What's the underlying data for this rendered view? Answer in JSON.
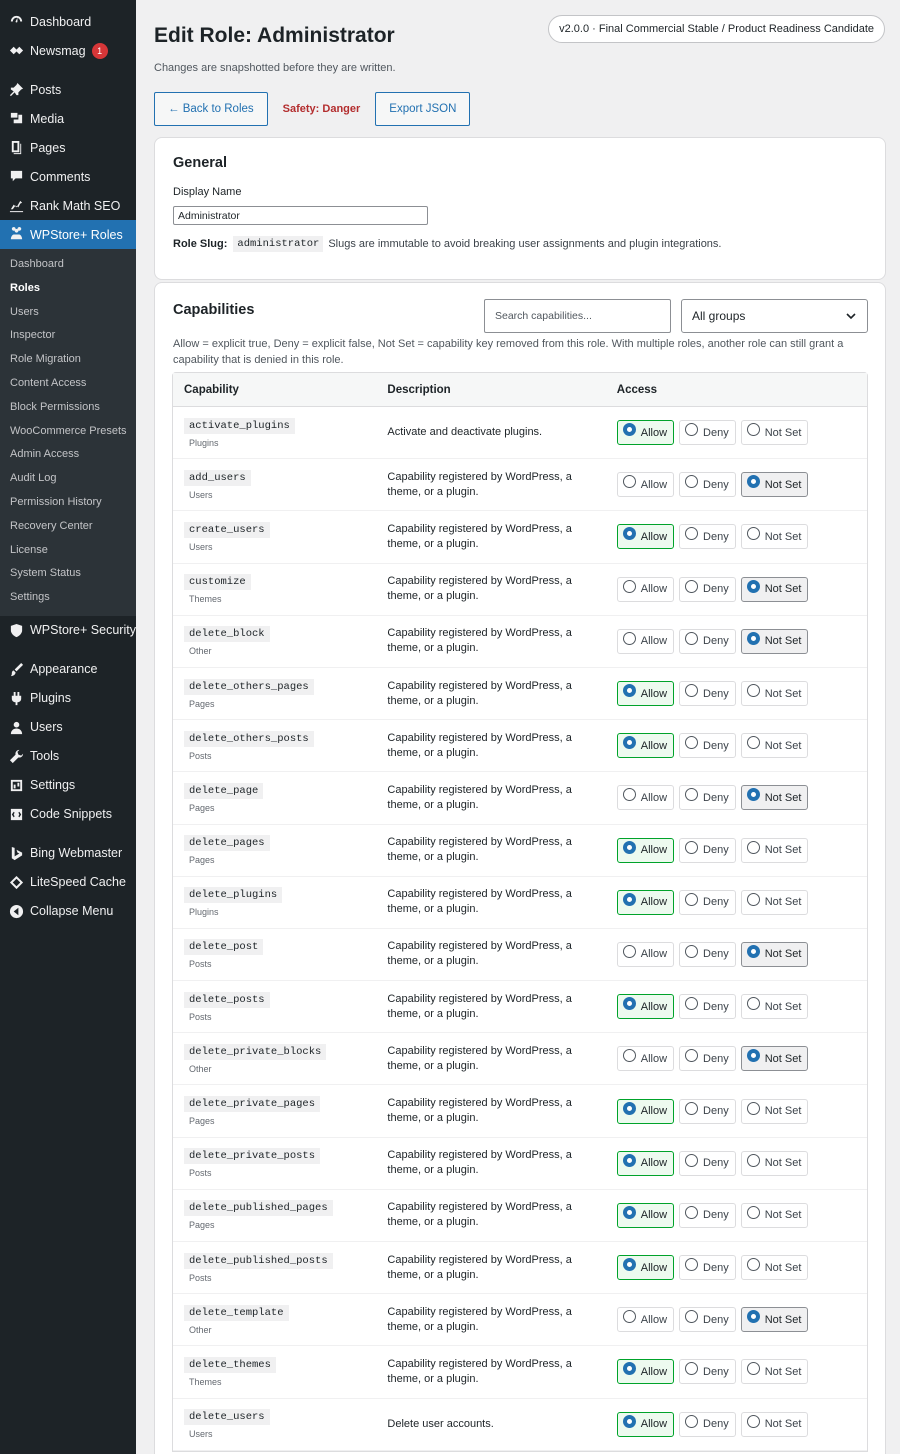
{
  "sidebar": {
    "top_items": [
      {
        "label": "Dashboard",
        "icon": "dashboard-icon"
      },
      {
        "label": "Newsmag",
        "icon": "newsmag-icon",
        "badge": "1"
      }
    ],
    "content_items": [
      {
        "label": "Posts",
        "icon": "pin-icon"
      },
      {
        "label": "Media",
        "icon": "media-icon"
      },
      {
        "label": "Pages",
        "icon": "pages-icon"
      },
      {
        "label": "Comments",
        "icon": "comments-icon"
      },
      {
        "label": "Rank Math SEO",
        "icon": "chart-icon"
      }
    ],
    "current_item": {
      "label": "WPStore+ Roles",
      "icon": "roles-icon"
    },
    "submenu": [
      "Dashboard",
      "Roles",
      "Users",
      "Inspector",
      "Role Migration",
      "Content Access",
      "Block Permissions",
      "WooCommerce Presets",
      "Admin Access",
      "Audit Log",
      "Permission History",
      "Recovery Center",
      "License",
      "System Status",
      "Settings"
    ],
    "submenu_current": "Roles",
    "security_item": {
      "label": "WPStore+ Security",
      "icon": "shield-icon"
    },
    "admin_items": [
      {
        "label": "Appearance",
        "icon": "brush-icon"
      },
      {
        "label": "Plugins",
        "icon": "plugin-icon"
      },
      {
        "label": "Users",
        "icon": "user-icon"
      },
      {
        "label": "Tools",
        "icon": "wrench-icon"
      },
      {
        "label": "Settings",
        "icon": "settings-icon"
      },
      {
        "label": "Code Snippets",
        "icon": "code-icon"
      }
    ],
    "extra_items": [
      {
        "label": "Bing Webmaster",
        "icon": "bing-icon"
      },
      {
        "label": "LiteSpeed Cache",
        "icon": "diamond-icon"
      },
      {
        "label": "Collapse Menu",
        "icon": "collapse-icon"
      }
    ]
  },
  "header": {
    "version": "v2.0.0 · Final Commercial Stable / Product Readiness Candidate",
    "title": "Edit Role: Administrator",
    "subtitle": "Changes are snapshotted before they are written.",
    "back_label": "← Back to Roles",
    "safety_label": "Safety: Danger",
    "export_label": "Export JSON"
  },
  "general": {
    "title": "General",
    "display_name_label": "Display Name",
    "display_name_value": "Administrator",
    "slug_label": "Role Slug:",
    "slug_value": "administrator",
    "slug_note": "Slugs are immutable to avoid breaking user assignments and plugin integrations."
  },
  "capabilities": {
    "title": "Capabilities",
    "search_placeholder": "Search capabilities...",
    "group_select": "All groups",
    "help": "Allow = explicit true, Deny = explicit false, Not Set = capability key removed from this role. With multiple roles, another role can still grant a capability that is denied in this role.",
    "columns": [
      "Capability",
      "Description",
      "Access"
    ],
    "options": {
      "allow": "Allow",
      "deny": "Deny",
      "notset": "Not Set"
    },
    "rows": [
      {
        "name": "activate_plugins",
        "group": "Plugins",
        "desc": "Activate and deactivate plugins.",
        "access": "allow"
      },
      {
        "name": "add_users",
        "group": "Users",
        "desc": "Capability registered by WordPress, a theme, or a plugin.",
        "access": "notset"
      },
      {
        "name": "create_users",
        "group": "Users",
        "desc": "Capability registered by WordPress, a theme, or a plugin.",
        "access": "allow"
      },
      {
        "name": "customize",
        "group": "Themes",
        "desc": "Capability registered by WordPress, a theme, or a plugin.",
        "access": "notset"
      },
      {
        "name": "delete_block",
        "group": "Other",
        "desc": "Capability registered by WordPress, a theme, or a plugin.",
        "access": "notset"
      },
      {
        "name": "delete_others_pages",
        "group": "Pages",
        "desc": "Capability registered by WordPress, a theme, or a plugin.",
        "access": "allow"
      },
      {
        "name": "delete_others_posts",
        "group": "Posts",
        "desc": "Capability registered by WordPress, a theme, or a plugin.",
        "access": "allow"
      },
      {
        "name": "delete_page",
        "group": "Pages",
        "desc": "Capability registered by WordPress, a theme, or a plugin.",
        "access": "notset"
      },
      {
        "name": "delete_pages",
        "group": "Pages",
        "desc": "Capability registered by WordPress, a theme, or a plugin.",
        "access": "allow"
      },
      {
        "name": "delete_plugins",
        "group": "Plugins",
        "desc": "Capability registered by WordPress, a theme, or a plugin.",
        "access": "allow"
      },
      {
        "name": "delete_post",
        "group": "Posts",
        "desc": "Capability registered by WordPress, a theme, or a plugin.",
        "access": "notset"
      },
      {
        "name": "delete_posts",
        "group": "Posts",
        "desc": "Capability registered by WordPress, a theme, or a plugin.",
        "access": "allow"
      },
      {
        "name": "delete_private_blocks",
        "group": "Other",
        "desc": "Capability registered by WordPress, a theme, or a plugin.",
        "access": "notset"
      },
      {
        "name": "delete_private_pages",
        "group": "Pages",
        "desc": "Capability registered by WordPress, a theme, or a plugin.",
        "access": "allow"
      },
      {
        "name": "delete_private_posts",
        "group": "Posts",
        "desc": "Capability registered by WordPress, a theme, or a plugin.",
        "access": "allow"
      },
      {
        "name": "delete_published_pages",
        "group": "Pages",
        "desc": "Capability registered by WordPress, a theme, or a plugin.",
        "access": "allow"
      },
      {
        "name": "delete_published_posts",
        "group": "Posts",
        "desc": "Capability registered by WordPress, a theme, or a plugin.",
        "access": "allow"
      },
      {
        "name": "delete_template",
        "group": "Other",
        "desc": "Capability registered by WordPress, a theme, or a plugin.",
        "access": "notset"
      },
      {
        "name": "delete_themes",
        "group": "Themes",
        "desc": "Capability registered by WordPress, a theme, or a plugin.",
        "access": "allow"
      },
      {
        "name": "delete_users",
        "group": "Users",
        "desc": "Delete user accounts.",
        "access": "allow"
      }
    ]
  },
  "colors": {
    "accent": "#2271b1",
    "sidebar_bg": "#1d2327",
    "danger": "#b32d2e",
    "allow_border": "#00a32a"
  }
}
